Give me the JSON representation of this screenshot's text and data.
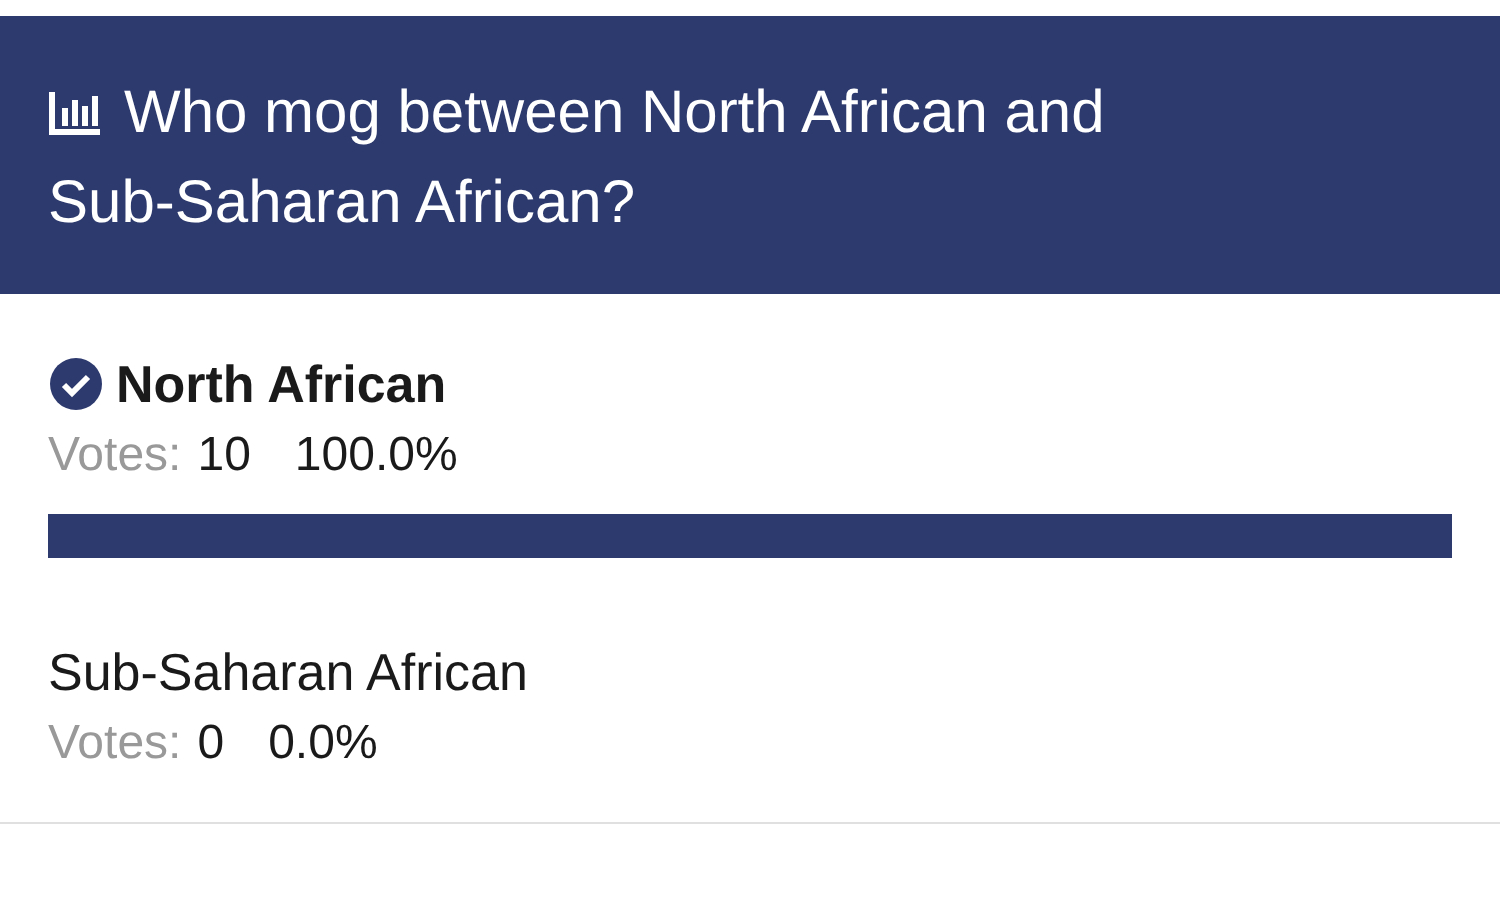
{
  "poll": {
    "title": "Who mog between North African and Sub-Saharan African?",
    "options": [
      {
        "label": "North African",
        "selected": true,
        "votes_label": "Votes:",
        "votes": "10",
        "percent": "100.0%"
      },
      {
        "label": "Sub-Saharan African",
        "selected": false,
        "votes_label": "Votes:",
        "votes": "0",
        "percent": "0.0%"
      }
    ]
  }
}
